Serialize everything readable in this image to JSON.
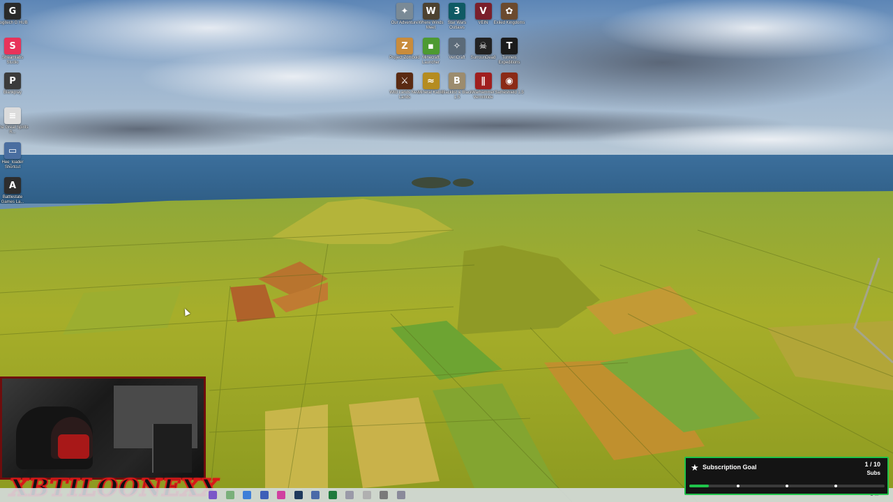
{
  "desktop": {
    "left_icons": [
      {
        "label": "Logitech G HUB",
        "icon": "logitech-g-icon",
        "color": "#2a2a2a",
        "glyph": "G"
      },
      {
        "label": "Streamlabs Studio",
        "icon": "streamlabs-icon",
        "color": "#e8335a",
        "glyph": "S"
      },
      {
        "label": "Blankplay",
        "icon": "blankplay-icon",
        "color": "#3b3b3b",
        "glyph": "P"
      },
      {
        "label": "The Great Spirits R...",
        "icon": "document-icon",
        "color": "#dcdcdc",
        "glyph": "≡"
      },
      {
        "label": "Hee_loader Shortcut",
        "icon": "shortcut-icon",
        "color": "#4a6ea0",
        "glyph": "▭"
      },
      {
        "label": "Battlestate Games La...",
        "icon": "battlestate-icon",
        "color": "#2d2d2d",
        "glyph": "A"
      }
    ],
    "top_icons": [
      {
        "label": "Our Adventure",
        "icon": "our-adventure-icon",
        "color": "#7a8a96",
        "glyph": "✦"
      },
      {
        "label": "Where Winds Meet",
        "icon": "where-winds-meet-icon",
        "color": "#4d4230",
        "glyph": "W"
      },
      {
        "label": "Star Wars Outlaws",
        "icon": "star-wars-outlaws-icon",
        "color": "#0f5a64",
        "glyph": "3"
      },
      {
        "label": "VEIN",
        "icon": "vein-icon",
        "color": "#7a1f2b",
        "glyph": "V"
      },
      {
        "label": "Exiled Kingdoms",
        "icon": "exiled-kingdoms-icon",
        "color": "#6b4a2e",
        "glyph": "✿"
      },
      {
        "label": "Project Zomboid",
        "icon": "project-zomboid-icon",
        "color": "#c98c3c",
        "glyph": "Z"
      },
      {
        "label": "Minecraft Launcher",
        "icon": "minecraft-icon",
        "color": "#4d9a32",
        "glyph": "▪"
      },
      {
        "label": "VeriCraft",
        "icon": "vericraft-icon",
        "color": "#5b6a78",
        "glyph": "✧"
      },
      {
        "label": "SurrounDead",
        "icon": "surroundead-icon",
        "color": "#222222",
        "glyph": "☠"
      },
      {
        "label": "Tunnels Expeditions",
        "icon": "tunnels-icon",
        "color": "#1b1b1b",
        "glyph": "T"
      },
      {
        "label": "Wild Lands New Lands",
        "icon": "wild-lands-icon",
        "color": "#5a2a12",
        "glyph": "⚔"
      },
      {
        "label": "Mineral Kable",
        "icon": "mineral-icon",
        "color": "#b58c20",
        "glyph": "≈"
      },
      {
        "label": "Blacklist & Black 1.5",
        "icon": "blacklist-icon",
        "color": "#9c8c6e",
        "glyph": "B"
      },
      {
        "label": "Warhammer Vermintide",
        "icon": "warhammer-icon",
        "color": "#a01e1e",
        "glyph": "∥"
      },
      {
        "label": "Sameshield 1.5",
        "icon": "sameshield-icon",
        "color": "#8b2a16",
        "glyph": "◉"
      }
    ]
  },
  "taskbar": {
    "icons": [
      {
        "icon": "app-icon",
        "color": "#7a57c8"
      },
      {
        "icon": "app-icon",
        "color": "#7ab07a"
      },
      {
        "icon": "app-icon",
        "color": "#3d7ed8"
      },
      {
        "icon": "app-icon",
        "color": "#3d5fb8"
      },
      {
        "icon": "app-icon",
        "color": "#d040a0"
      },
      {
        "icon": "steam-icon",
        "color": "#1f3a5c"
      },
      {
        "icon": "app-icon",
        "color": "#4a6aa8"
      },
      {
        "icon": "excel-icon",
        "color": "#1f7a3c"
      },
      {
        "icon": "app-icon",
        "color": "#9a9aa8"
      },
      {
        "icon": "app-icon",
        "color": "#b0b0b0"
      },
      {
        "icon": "gear-icon",
        "color": "#7a7a7a"
      },
      {
        "icon": "app-icon",
        "color": "#8a8a9a"
      }
    ]
  },
  "overlay": {
    "streamer_name": "XBTILOONEXX"
  },
  "sub_goal": {
    "title": "Subscription Goal",
    "count": "1 / 10",
    "unit": "Subs",
    "progress": 0.1,
    "milestones": [
      0.25,
      0.5,
      0.75
    ],
    "accent": "#1fc34a"
  }
}
